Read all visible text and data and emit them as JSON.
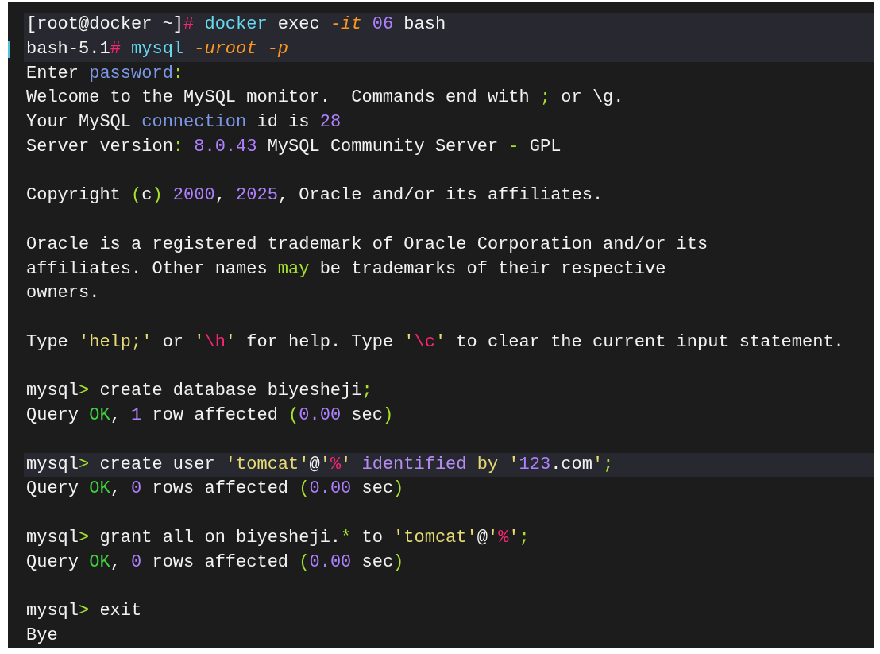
{
  "terminal": {
    "lines": [
      {
        "kind": "text",
        "highlighted": true,
        "marked": false,
        "segments": [
          {
            "kind": "plain",
            "text": "[root@docker ~]"
          },
          {
            "kind": "pink",
            "text": "#"
          },
          {
            "kind": "cmd",
            "text": " docker"
          },
          {
            "kind": "plain",
            "text": " exec "
          },
          {
            "kind": "flag",
            "text": "-it"
          },
          {
            "kind": "num",
            "text": " 06"
          },
          {
            "kind": "plain",
            "text": " bash"
          }
        ]
      },
      {
        "kind": "text",
        "highlighted": true,
        "marked": true,
        "segments": [
          {
            "kind": "plain",
            "text": "bash-5.1"
          },
          {
            "kind": "pink",
            "text": "#"
          },
          {
            "kind": "cmd",
            "text": " mysql"
          },
          {
            "kind": "flag",
            "text": " -uroot -p"
          }
        ]
      },
      {
        "kind": "text",
        "highlighted": false,
        "marked": false,
        "segments": [
          {
            "kind": "plain",
            "text": "Enter "
          },
          {
            "kind": "var",
            "text": "password"
          },
          {
            "kind": "op",
            "text": ":"
          }
        ]
      },
      {
        "kind": "text",
        "highlighted": false,
        "marked": false,
        "segments": [
          {
            "kind": "plain",
            "text": "Welcome to the MySQL monitor.  Commands end with "
          },
          {
            "kind": "op",
            "text": ";"
          },
          {
            "kind": "plain",
            "text": " or \\g."
          }
        ]
      },
      {
        "kind": "text",
        "highlighted": false,
        "marked": false,
        "segments": [
          {
            "kind": "plain",
            "text": "Your MySQL "
          },
          {
            "kind": "var",
            "text": "connection"
          },
          {
            "kind": "plain",
            "text": " id is "
          },
          {
            "kind": "num",
            "text": "28"
          }
        ]
      },
      {
        "kind": "text",
        "highlighted": false,
        "marked": false,
        "segments": [
          {
            "kind": "plain",
            "text": "Server version"
          },
          {
            "kind": "op",
            "text": ":"
          },
          {
            "kind": "num",
            "text": " 8.0.43"
          },
          {
            "kind": "plain",
            "text": " MySQL Community Server "
          },
          {
            "kind": "op",
            "text": "-"
          },
          {
            "kind": "plain",
            "text": " GPL"
          }
        ]
      },
      {
        "kind": "blank",
        "highlighted": false,
        "marked": false
      },
      {
        "kind": "text",
        "highlighted": false,
        "marked": false,
        "segments": [
          {
            "kind": "plain",
            "text": "Copyright "
          },
          {
            "kind": "op",
            "text": "("
          },
          {
            "kind": "plain",
            "text": "c"
          },
          {
            "kind": "op",
            "text": ")"
          },
          {
            "kind": "num",
            "text": " 2000"
          },
          {
            "kind": "plain",
            "text": ", "
          },
          {
            "kind": "num",
            "text": "2025"
          },
          {
            "kind": "plain",
            "text": ", Oracle and/or its affiliates."
          }
        ]
      },
      {
        "kind": "blank",
        "highlighted": false,
        "marked": false
      },
      {
        "kind": "text",
        "highlighted": false,
        "marked": false,
        "segments": [
          {
            "kind": "plain",
            "text": "Oracle is a registered trademark of Oracle Corporation and/or its"
          }
        ]
      },
      {
        "kind": "text",
        "highlighted": false,
        "marked": false,
        "segments": [
          {
            "kind": "plain",
            "text": "affiliates. Other names "
          },
          {
            "kind": "op",
            "text": "may"
          },
          {
            "kind": "plain",
            "text": " be trademarks of their respective"
          }
        ]
      },
      {
        "kind": "text",
        "highlighted": false,
        "marked": false,
        "segments": [
          {
            "kind": "plain",
            "text": "owners."
          }
        ]
      },
      {
        "kind": "blank",
        "highlighted": false,
        "marked": false
      },
      {
        "kind": "text",
        "highlighted": false,
        "marked": false,
        "segments": [
          {
            "kind": "plain",
            "text": "Type "
          },
          {
            "kind": "str",
            "text": "'help;'"
          },
          {
            "kind": "plain",
            "text": " or "
          },
          {
            "kind": "str",
            "text": "'"
          },
          {
            "kind": "pink",
            "text": "\\h"
          },
          {
            "kind": "str",
            "text": "'"
          },
          {
            "kind": "plain",
            "text": " for help. Type "
          },
          {
            "kind": "str",
            "text": "'"
          },
          {
            "kind": "pink",
            "text": "\\c"
          },
          {
            "kind": "str",
            "text": "'"
          },
          {
            "kind": "plain",
            "text": " to clear the current input statement."
          }
        ]
      },
      {
        "kind": "blank",
        "highlighted": false,
        "marked": false
      },
      {
        "kind": "text",
        "highlighted": false,
        "marked": false,
        "segments": [
          {
            "kind": "plain",
            "text": "mysql"
          },
          {
            "kind": "op",
            "text": ">"
          },
          {
            "kind": "plain",
            "text": " create database biyesheji"
          },
          {
            "kind": "op",
            "text": ";"
          }
        ]
      },
      {
        "kind": "text",
        "highlighted": false,
        "marked": false,
        "segments": [
          {
            "kind": "plain",
            "text": "Query "
          },
          {
            "kind": "ok",
            "text": "OK"
          },
          {
            "kind": "plain",
            "text": ", "
          },
          {
            "kind": "num",
            "text": "1"
          },
          {
            "kind": "plain",
            "text": " row affected "
          },
          {
            "kind": "op",
            "text": "("
          },
          {
            "kind": "num",
            "text": "0.00"
          },
          {
            "kind": "plain",
            "text": " sec"
          },
          {
            "kind": "op",
            "text": ")"
          }
        ]
      },
      {
        "kind": "blank",
        "highlighted": false,
        "marked": false
      },
      {
        "kind": "text",
        "highlighted": true,
        "marked": false,
        "segments": [
          {
            "kind": "plain",
            "text": "mysql"
          },
          {
            "kind": "op",
            "text": ">"
          },
          {
            "kind": "plain",
            "text": " create user "
          },
          {
            "kind": "str",
            "text": "'tomcat'"
          },
          {
            "kind": "plain",
            "text": "@"
          },
          {
            "kind": "str",
            "text": "'"
          },
          {
            "kind": "pink",
            "text": "%"
          },
          {
            "kind": "str",
            "text": "'"
          },
          {
            "kind": "kw",
            "text": " identified"
          },
          {
            "kind": "str",
            "text": " by '"
          },
          {
            "kind": "num",
            "text": "123"
          },
          {
            "kind": "plain",
            "text": ".com"
          },
          {
            "kind": "str",
            "text": "'"
          },
          {
            "kind": "op",
            "text": ";"
          }
        ]
      },
      {
        "kind": "text",
        "highlighted": false,
        "marked": false,
        "segments": [
          {
            "kind": "plain",
            "text": "Query "
          },
          {
            "kind": "ok",
            "text": "OK"
          },
          {
            "kind": "plain",
            "text": ", "
          },
          {
            "kind": "num",
            "text": "0"
          },
          {
            "kind": "plain",
            "text": " rows affected "
          },
          {
            "kind": "op",
            "text": "("
          },
          {
            "kind": "num",
            "text": "0.00"
          },
          {
            "kind": "plain",
            "text": " sec"
          },
          {
            "kind": "op",
            "text": ")"
          }
        ]
      },
      {
        "kind": "blank",
        "highlighted": false,
        "marked": false
      },
      {
        "kind": "text",
        "highlighted": false,
        "marked": false,
        "segments": [
          {
            "kind": "plain",
            "text": "mysql"
          },
          {
            "kind": "op",
            "text": ">"
          },
          {
            "kind": "plain",
            "text": " grant all on biyesheji."
          },
          {
            "kind": "op",
            "text": "*"
          },
          {
            "kind": "plain",
            "text": " to "
          },
          {
            "kind": "str",
            "text": "'tomcat'"
          },
          {
            "kind": "plain",
            "text": "@"
          },
          {
            "kind": "str",
            "text": "'"
          },
          {
            "kind": "pink",
            "text": "%"
          },
          {
            "kind": "str",
            "text": "'"
          },
          {
            "kind": "op",
            "text": ";"
          }
        ]
      },
      {
        "kind": "text",
        "highlighted": false,
        "marked": false,
        "segments": [
          {
            "kind": "plain",
            "text": "Query "
          },
          {
            "kind": "ok",
            "text": "OK"
          },
          {
            "kind": "plain",
            "text": ", "
          },
          {
            "kind": "num",
            "text": "0"
          },
          {
            "kind": "plain",
            "text": " rows affected "
          },
          {
            "kind": "op",
            "text": "("
          },
          {
            "kind": "num",
            "text": "0.00"
          },
          {
            "kind": "plain",
            "text": " sec"
          },
          {
            "kind": "op",
            "text": ")"
          }
        ]
      },
      {
        "kind": "blank",
        "highlighted": false,
        "marked": false
      },
      {
        "kind": "text",
        "highlighted": false,
        "marked": false,
        "segments": [
          {
            "kind": "plain",
            "text": "mysql"
          },
          {
            "kind": "op",
            "text": ">"
          },
          {
            "kind": "plain",
            "text": " exit"
          }
        ]
      },
      {
        "kind": "text",
        "highlighted": false,
        "marked": false,
        "segments": [
          {
            "kind": "plain",
            "text": "Bye"
          }
        ]
      }
    ]
  }
}
